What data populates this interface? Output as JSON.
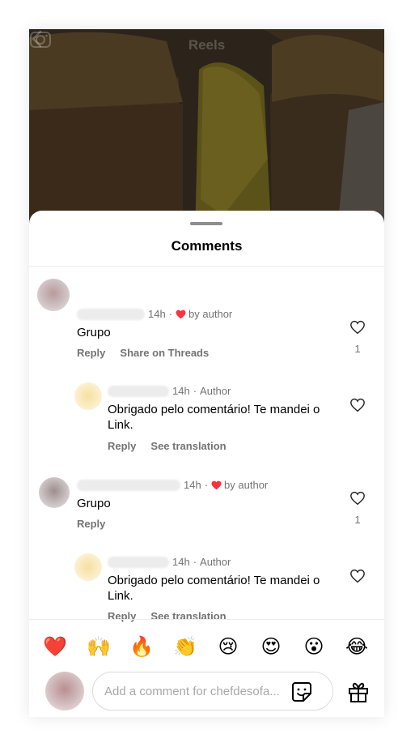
{
  "header": {
    "title": "Reels"
  },
  "sheet": {
    "title": "Comments"
  },
  "comments": [
    {
      "time": "14h",
      "separator": "·",
      "liked_by_author_text": "by author",
      "text": "Grupo",
      "reply_label": "Reply",
      "share_label": "Share on Threads",
      "like_count": "1",
      "reply": {
        "time": "14h",
        "separator": "·",
        "author_label": "Author",
        "text": "Obrigado pelo comentário! Te mandei o Link.",
        "reply_label": "Reply",
        "translate_label": "See translation"
      }
    },
    {
      "time": "14h",
      "separator": "·",
      "liked_by_author_text": "by author",
      "text": "Grupo",
      "reply_label": "Reply",
      "like_count": "1",
      "reply": {
        "time": "14h",
        "separator": "·",
        "author_label": "Author",
        "text": "Obrigado pelo comentário! Te mandei o Link.",
        "reply_label": "Reply",
        "translate_label": "See translation"
      }
    }
  ],
  "emoji_bar": [
    "❤️",
    "🙌",
    "🔥",
    "👏",
    "😢",
    "😍",
    "😮",
    "😂"
  ],
  "input": {
    "placeholder": "Add a comment for chefdesofa..."
  },
  "colors": {
    "heart_red": "#ff3040",
    "secondary_text": "#737373",
    "divider": "#ebebeb"
  },
  "icons": [
    "back-icon",
    "camera-icon",
    "heart-icon",
    "sticker-icon",
    "gift-icon"
  ]
}
